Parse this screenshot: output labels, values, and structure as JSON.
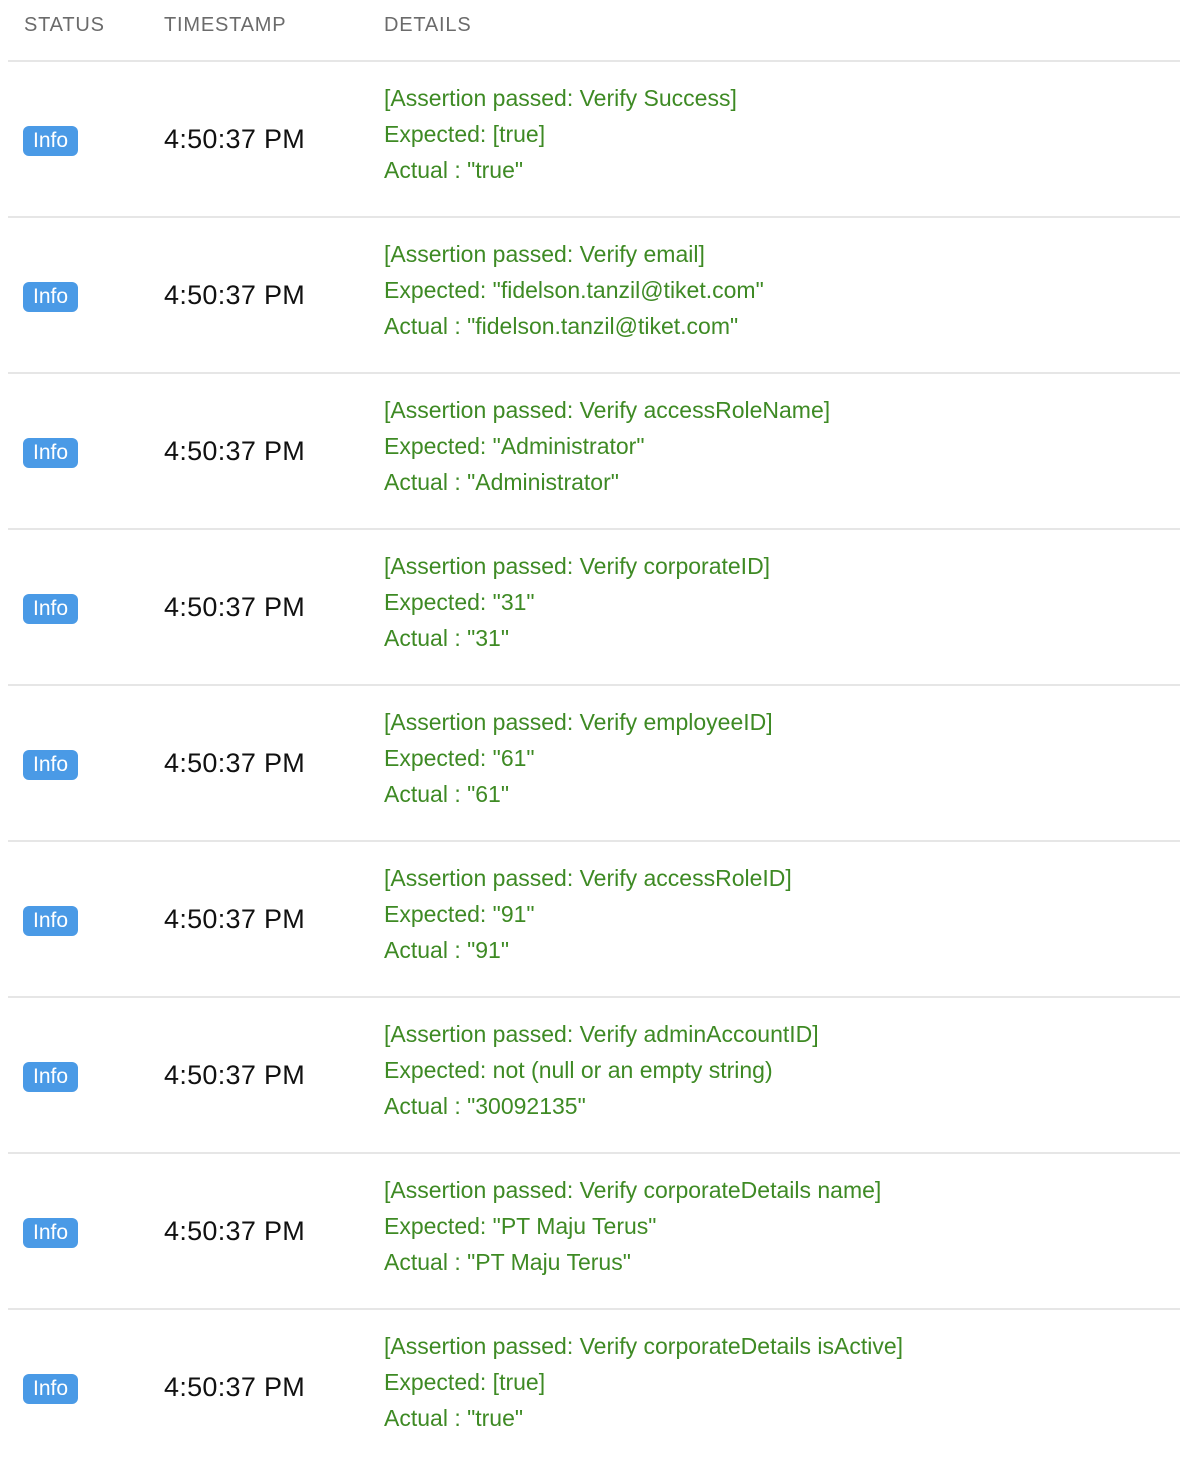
{
  "header": {
    "status": "STATUS",
    "timestamp": "TIMESTAMP",
    "details": "DETAILS"
  },
  "rows": [
    {
      "status": "Info",
      "timestamp": "4:50:37 PM",
      "assertion": "[Assertion passed: Verify Success]",
      "expected": "Expected: [true]",
      "actual": "Actual : \"true\""
    },
    {
      "status": "Info",
      "timestamp": "4:50:37 PM",
      "assertion": "[Assertion passed: Verify email]",
      "expected": "Expected: \"fidelson.tanzil@tiket.com\"",
      "actual": "Actual : \"fidelson.tanzil@tiket.com\""
    },
    {
      "status": "Info",
      "timestamp": "4:50:37 PM",
      "assertion": "[Assertion passed: Verify accessRoleName]",
      "expected": "Expected: \"Administrator\"",
      "actual": "Actual : \"Administrator\""
    },
    {
      "status": "Info",
      "timestamp": "4:50:37 PM",
      "assertion": "[Assertion passed: Verify corporateID]",
      "expected": "Expected: \"31\"",
      "actual": "Actual : \"31\""
    },
    {
      "status": "Info",
      "timestamp": "4:50:37 PM",
      "assertion": "[Assertion passed: Verify employeeID]",
      "expected": "Expected: \"61\"",
      "actual": "Actual : \"61\""
    },
    {
      "status": "Info",
      "timestamp": "4:50:37 PM",
      "assertion": "[Assertion passed: Verify accessRoleID]",
      "expected": "Expected: \"91\"",
      "actual": "Actual : \"91\""
    },
    {
      "status": "Info",
      "timestamp": "4:50:37 PM",
      "assertion": "[Assertion passed: Verify adminAccountID]",
      "expected": "Expected: not (null or an empty string)",
      "actual": "Actual : \"30092135\""
    },
    {
      "status": "Info",
      "timestamp": "4:50:37 PM",
      "assertion": "[Assertion passed: Verify corporateDetails name]",
      "expected": "Expected: \"PT Maju Terus\"",
      "actual": "Actual : \"PT Maju Terus\""
    },
    {
      "status": "Info",
      "timestamp": "4:50:37 PM",
      "assertion": "[Assertion passed: Verify corporateDetails isActive]",
      "expected": "Expected: [true]",
      "actual": "Actual : \"true\""
    }
  ],
  "colors": {
    "info_badge": "#4a9ae6",
    "pass_text": "#3e8a24",
    "divider": "#e6e6e6",
    "header_text": "#6b6b6b"
  }
}
